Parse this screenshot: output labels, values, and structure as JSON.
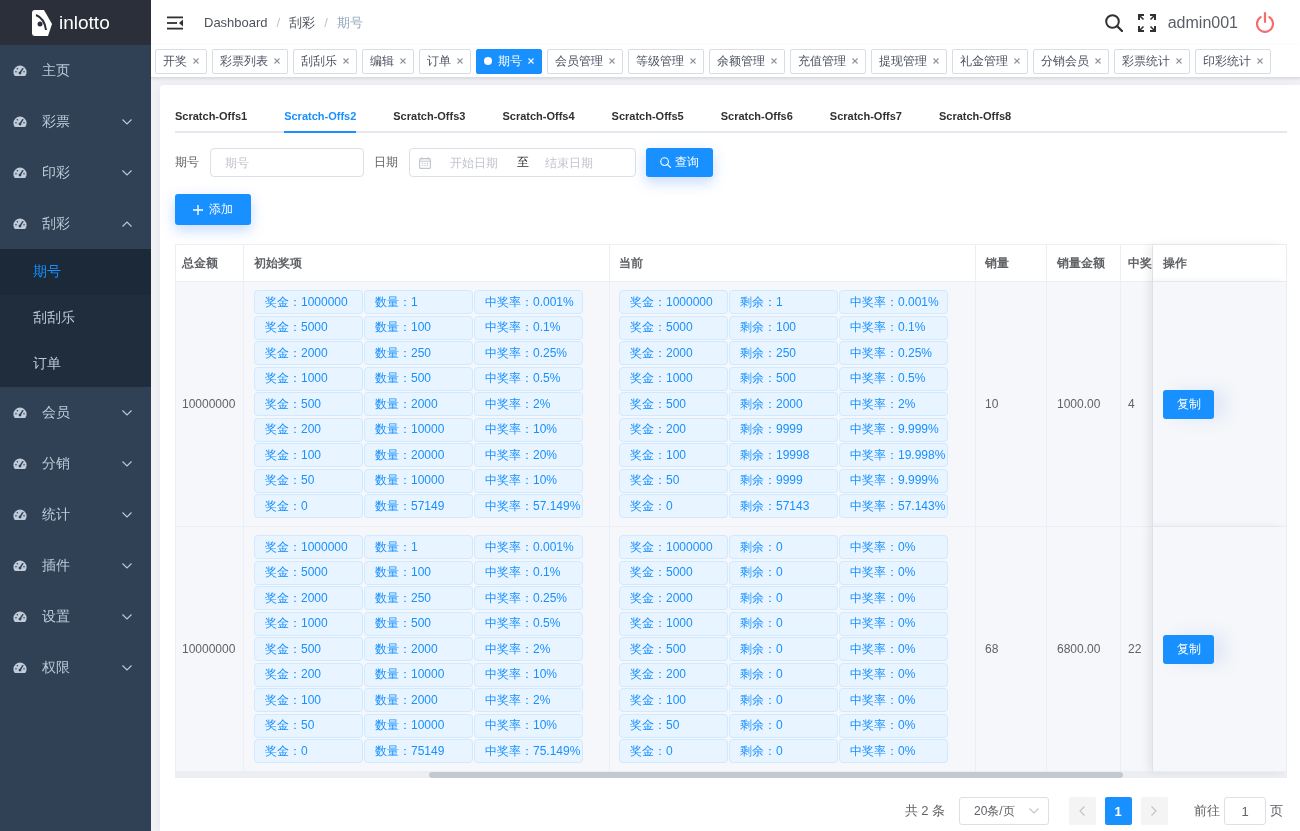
{
  "sidebar": {
    "logo": "inlotto",
    "menu": [
      {
        "kind": "link",
        "label": "主页",
        "selected": false
      },
      {
        "kind": "submenu",
        "label": "彩票",
        "expanded": false
      },
      {
        "kind": "submenu",
        "label": "印彩",
        "expanded": false
      },
      {
        "kind": "submenu",
        "label": "刮彩",
        "expanded": true,
        "children": [
          {
            "label": "期号",
            "selected": true
          },
          {
            "label": "刮刮乐",
            "selected": false
          },
          {
            "label": "订单",
            "selected": false
          }
        ]
      },
      {
        "kind": "submenu",
        "label": "会员",
        "expanded": false
      },
      {
        "kind": "submenu",
        "label": "分销",
        "expanded": false
      },
      {
        "kind": "submenu",
        "label": "统计",
        "expanded": false
      },
      {
        "kind": "submenu",
        "label": "插件",
        "expanded": false
      },
      {
        "kind": "submenu",
        "label": "设置",
        "expanded": false
      },
      {
        "kind": "submenu",
        "label": "权限",
        "expanded": false
      }
    ]
  },
  "navbar": {
    "breadcrumb": [
      {
        "label": "Dashboard"
      },
      {
        "separator": "/",
        "label": "刮彩"
      },
      {
        "separator": "/",
        "label": "期号"
      }
    ],
    "username": "admin001"
  },
  "tags_view": [
    {
      "label": "开奖",
      "selected": false
    },
    {
      "label": "彩票列表",
      "selected": false
    },
    {
      "label": "刮刮乐",
      "selected": false
    },
    {
      "label": "编辑",
      "selected": false
    },
    {
      "label": "订单",
      "selected": false
    },
    {
      "label": "期号",
      "selected": true
    },
    {
      "label": "会员管理",
      "selected": false
    },
    {
      "label": "等级管理",
      "selected": false
    },
    {
      "label": "余额管理",
      "selected": false
    },
    {
      "label": "充值管理",
      "selected": false
    },
    {
      "label": "提现管理",
      "selected": false
    },
    {
      "label": "礼金管理",
      "selected": false
    },
    {
      "label": "分销会员",
      "selected": false
    },
    {
      "label": "彩票统计",
      "selected": false
    },
    {
      "label": "印彩统计",
      "selected": false
    }
  ],
  "tabs": [
    {
      "label": "Scratch-Offs1",
      "selected": false
    },
    {
      "label": "Scratch-Offs2",
      "selected": true
    },
    {
      "label": "Scratch-Offs3",
      "selected": false
    },
    {
      "label": "Scratch-Offs4",
      "selected": false
    },
    {
      "label": "Scratch-Offs5",
      "selected": false
    },
    {
      "label": "Scratch-Offs6",
      "selected": false
    },
    {
      "label": "Scratch-Offs7",
      "selected": false
    },
    {
      "label": "Scratch-Offs8",
      "selected": false
    }
  ],
  "filters": {
    "issue": {
      "label": "期号",
      "placeholder": "期号"
    },
    "date_range": {
      "label": "日期",
      "start_placeholder": "开始日期",
      "separator": "至",
      "end_placeholder": "结束日期"
    },
    "search_button": "查询"
  },
  "add_button": "添加",
  "table": {
    "columns": [
      "总金额",
      "初始奖项",
      "当前",
      "销量",
      "销量金额",
      "中奖",
      "操作"
    ],
    "rows": [
      {
        "total_amount": "10000000",
        "initial_prizes": [
          {
            "prize": "奖金：1000000",
            "count": "数量：1",
            "rate": "中奖率：0.001%"
          },
          {
            "prize": "奖金：5000",
            "count": "数量：100",
            "rate": "中奖率：0.1%"
          },
          {
            "prize": "奖金：2000",
            "count": "数量：250",
            "rate": "中奖率：0.25%"
          },
          {
            "prize": "奖金：1000",
            "count": "数量：500",
            "rate": "中奖率：0.5%"
          },
          {
            "prize": "奖金：500",
            "count": "数量：2000",
            "rate": "中奖率：2%"
          },
          {
            "prize": "奖金：200",
            "count": "数量：10000",
            "rate": "中奖率：10%"
          },
          {
            "prize": "奖金：100",
            "count": "数量：20000",
            "rate": "中奖率：20%"
          },
          {
            "prize": "奖金：50",
            "count": "数量：10000",
            "rate": "中奖率：10%"
          },
          {
            "prize": "奖金：0",
            "count": "数量：57149",
            "rate": "中奖率：57.149%"
          }
        ],
        "current_prizes": [
          {
            "prize": "奖金：1000000",
            "remaining": "剩余：1",
            "rate": "中奖率：0.001%"
          },
          {
            "prize": "奖金：5000",
            "remaining": "剩余：100",
            "rate": "中奖率：0.1%"
          },
          {
            "prize": "奖金：2000",
            "remaining": "剩余：250",
            "rate": "中奖率：0.25%"
          },
          {
            "prize": "奖金：1000",
            "remaining": "剩余：500",
            "rate": "中奖率：0.5%"
          },
          {
            "prize": "奖金：500",
            "remaining": "剩余：2000",
            "rate": "中奖率：2%"
          },
          {
            "prize": "奖金：200",
            "remaining": "剩余：9999",
            "rate": "中奖率：9.999%"
          },
          {
            "prize": "奖金：100",
            "remaining": "剩余：19998",
            "rate": "中奖率：19.998%"
          },
          {
            "prize": "奖金：50",
            "remaining": "剩余：9999",
            "rate": "中奖率：9.999%"
          },
          {
            "prize": "奖金：0",
            "remaining": "剩余：57143",
            "rate": "中奖率：57.143%"
          }
        ],
        "sales": "10",
        "sales_amount": "1000.00",
        "column_6": "4",
        "action_button": "复制"
      },
      {
        "total_amount": "10000000",
        "initial_prizes": [
          {
            "prize": "奖金：1000000",
            "count": "数量：1",
            "rate": "中奖率：0.001%"
          },
          {
            "prize": "奖金：5000",
            "count": "数量：100",
            "rate": "中奖率：0.1%"
          },
          {
            "prize": "奖金：2000",
            "count": "数量：250",
            "rate": "中奖率：0.25%"
          },
          {
            "prize": "奖金：1000",
            "count": "数量：500",
            "rate": "中奖率：0.5%"
          },
          {
            "prize": "奖金：500",
            "count": "数量：2000",
            "rate": "中奖率：2%"
          },
          {
            "prize": "奖金：200",
            "count": "数量：10000",
            "rate": "中奖率：10%"
          },
          {
            "prize": "奖金：100",
            "count": "数量：2000",
            "rate": "中奖率：2%"
          },
          {
            "prize": "奖金：50",
            "count": "数量：10000",
            "rate": "中奖率：10%"
          },
          {
            "prize": "奖金：0",
            "count": "数量：75149",
            "rate": "中奖率：75.149%"
          }
        ],
        "current_prizes": [
          {
            "prize": "奖金：1000000",
            "remaining": "剩余：0",
            "rate": "中奖率：0%"
          },
          {
            "prize": "奖金：5000",
            "remaining": "剩余：0",
            "rate": "中奖率：0%"
          },
          {
            "prize": "奖金：2000",
            "remaining": "剩余：0",
            "rate": "中奖率：0%"
          },
          {
            "prize": "奖金：1000",
            "remaining": "剩余：0",
            "rate": "中奖率：0%"
          },
          {
            "prize": "奖金：500",
            "remaining": "剩余：0",
            "rate": "中奖率：0%"
          },
          {
            "prize": "奖金：200",
            "remaining": "剩余：0",
            "rate": "中奖率：0%"
          },
          {
            "prize": "奖金：100",
            "remaining": "剩余：0",
            "rate": "中奖率：0%"
          },
          {
            "prize": "奖金：50",
            "remaining": "剩余：0",
            "rate": "中奖率：0%"
          },
          {
            "prize": "奖金：0",
            "remaining": "剩余：0",
            "rate": "中奖率：0%"
          }
        ],
        "sales": "68",
        "sales_amount": "6800.00",
        "column_6": "22",
        "action_button": "复制"
      }
    ]
  },
  "pagination": {
    "total": "共 2 条",
    "page_size": "20条/页",
    "prev": {
      "disabled": true
    },
    "pages": [
      {
        "label": "1",
        "selected": true
      }
    ],
    "next": {
      "disabled": true
    },
    "jumper": {
      "prefix": "前往",
      "value": "1",
      "suffix": "页"
    }
  }
}
